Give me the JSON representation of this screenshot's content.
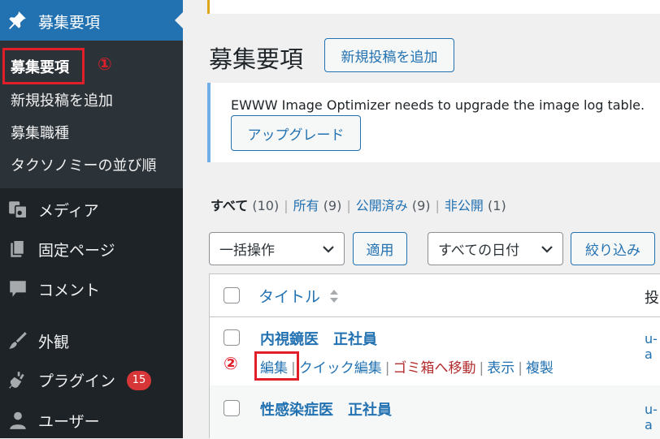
{
  "sidebar": {
    "active_menu": {
      "label": "募集要項",
      "icon": "pin-icon"
    },
    "submenu": [
      {
        "label": "募集要項",
        "current": true
      },
      {
        "label": "新規投稿を追加"
      },
      {
        "label": "募集職種"
      },
      {
        "label": "タクソノミーの並び順"
      }
    ],
    "menu": [
      {
        "label": "メディア",
        "icon": "media-icon"
      },
      {
        "label": "固定ページ",
        "icon": "page-icon"
      },
      {
        "label": "コメント",
        "icon": "comment-icon"
      },
      {
        "label": "外観",
        "icon": "brush-icon"
      },
      {
        "label": "プラグイン",
        "icon": "plugin-icon",
        "badge": "15"
      },
      {
        "label": "ユーザー",
        "icon": "user-icon"
      }
    ]
  },
  "annotations": {
    "step1": "①",
    "step2": "②"
  },
  "header": {
    "title": "募集要項",
    "add_new": "新規投稿を追加"
  },
  "notice": {
    "message": "EWWW Image Optimizer needs to upgrade the image log table.",
    "button": "アップグレード"
  },
  "filters": [
    {
      "label": "すべて",
      "count": "(10)",
      "current": true
    },
    {
      "label": "所有",
      "count": "(9)"
    },
    {
      "label": "公開済み",
      "count": "(9)"
    },
    {
      "label": "非公開",
      "count": "(1)"
    }
  ],
  "toolbar": {
    "bulk_action": "一括操作",
    "apply": "適用",
    "date_filter": "すべての日付",
    "filter": "絞り込み"
  },
  "table": {
    "col_title": "タイトル",
    "col_author": "投",
    "rows": [
      {
        "title": "内視鏡医　正社員",
        "author": "u-a",
        "actions": {
          "edit": "編集",
          "quick_edit": "クイック編集",
          "trash": "ゴミ箱へ移動",
          "view": "表示",
          "duplicate": "複製"
        }
      },
      {
        "title": "性感染症医　正社員",
        "author": "u-a"
      }
    ]
  },
  "colors": {
    "sidebar": "#1d2327",
    "submenu": "#2c3338",
    "accent": "#2271b1",
    "highlight": "#e01f2b",
    "badge": "#d63638"
  }
}
